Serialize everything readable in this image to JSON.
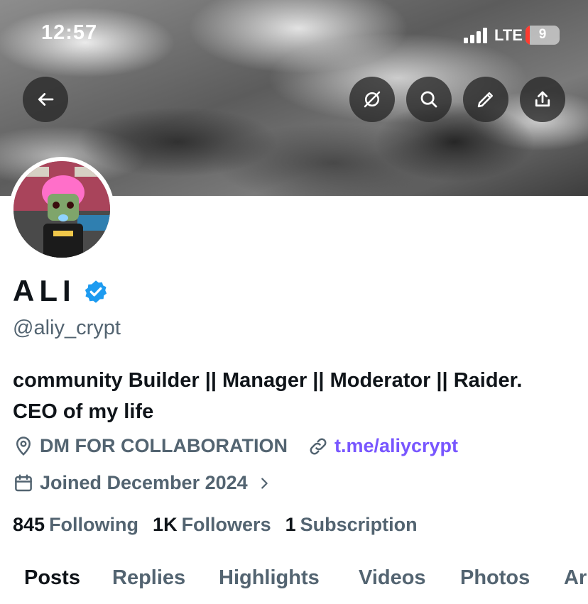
{
  "status_bar": {
    "time": "12:57",
    "network": "LTE",
    "battery": "9",
    "battery_color": "#ff3b30"
  },
  "header_buttons": {
    "back": "arrow-left-icon",
    "grok": "grok-icon",
    "search": "search-icon",
    "edit": "pencil-icon",
    "share": "share-icon"
  },
  "profile": {
    "display_name": "ALI",
    "verified_color": "#1d9bf0",
    "handle": "@aliy_crypt",
    "bio_line1": "community Builder || Manager || Moderator || Raider.",
    "bio_line2": "CEO of my life",
    "location": "DM FOR COLLABORATION",
    "link": "t.me/aliycrypt",
    "link_color": "#7856ff",
    "joined": "Joined December 2024"
  },
  "stats": {
    "following_count": "845",
    "following_label": "Following",
    "followers_count": "1K",
    "followers_label": "Followers",
    "subscription_count": "1",
    "subscription_label": "Subscription"
  },
  "tabs": {
    "posts": "Posts",
    "replies": "Replies",
    "highlights": "Highlights",
    "videos": "Videos",
    "photos": "Photos",
    "articles": "Ar"
  }
}
